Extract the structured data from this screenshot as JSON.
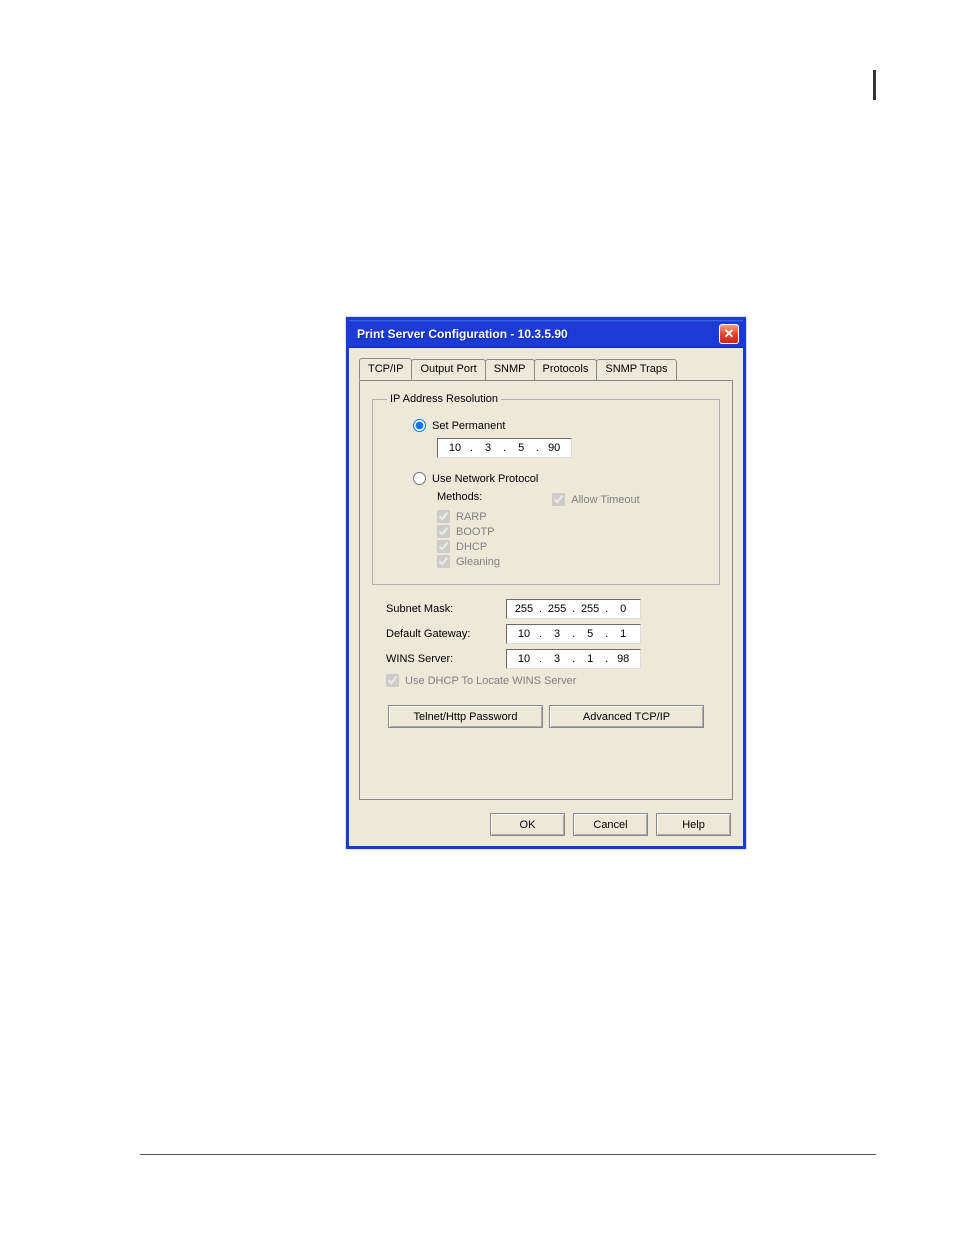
{
  "dialog": {
    "title": "Print Server Configuration - 10.3.5.90"
  },
  "tabs": [
    {
      "label": "TCP/IP",
      "active": true
    },
    {
      "label": "Output Port"
    },
    {
      "label": "SNMP"
    },
    {
      "label": "Protocols"
    },
    {
      "label": "SNMP Traps"
    }
  ],
  "groupbox": {
    "title": "IP Address Resolution",
    "set_permanent": {
      "label": "Set Permanent",
      "selected": true,
      "ip": [
        "10",
        "3",
        "5",
        "90"
      ]
    },
    "use_network": {
      "label": "Use Network Protocol",
      "selected": false,
      "methods_label": "Methods:",
      "allow_timeout": {
        "label": "Allow Timeout",
        "checked": true
      },
      "methods": [
        {
          "label": "RARP",
          "checked": true
        },
        {
          "label": "BOOTP",
          "checked": true
        },
        {
          "label": "DHCP",
          "checked": true
        },
        {
          "label": "Gleaning",
          "checked": true
        }
      ]
    }
  },
  "network": {
    "subnet": {
      "label": "Subnet Mask:",
      "ip": [
        "255",
        "255",
        "255",
        "0"
      ]
    },
    "gateway": {
      "label": "Default Gateway:",
      "ip": [
        "10",
        "3",
        "5",
        "1"
      ]
    },
    "wins": {
      "label": "WINS Server:",
      "ip": [
        "10",
        "3",
        "1",
        "98"
      ]
    },
    "dhcp_wins": {
      "label": "Use DHCP To Locate WINS Server",
      "checked": true
    }
  },
  "buttons": {
    "telnet": "Telnet/Http Password",
    "advanced": "Advanced TCP/IP",
    "ok": "OK",
    "cancel": "Cancel",
    "help": "Help"
  }
}
